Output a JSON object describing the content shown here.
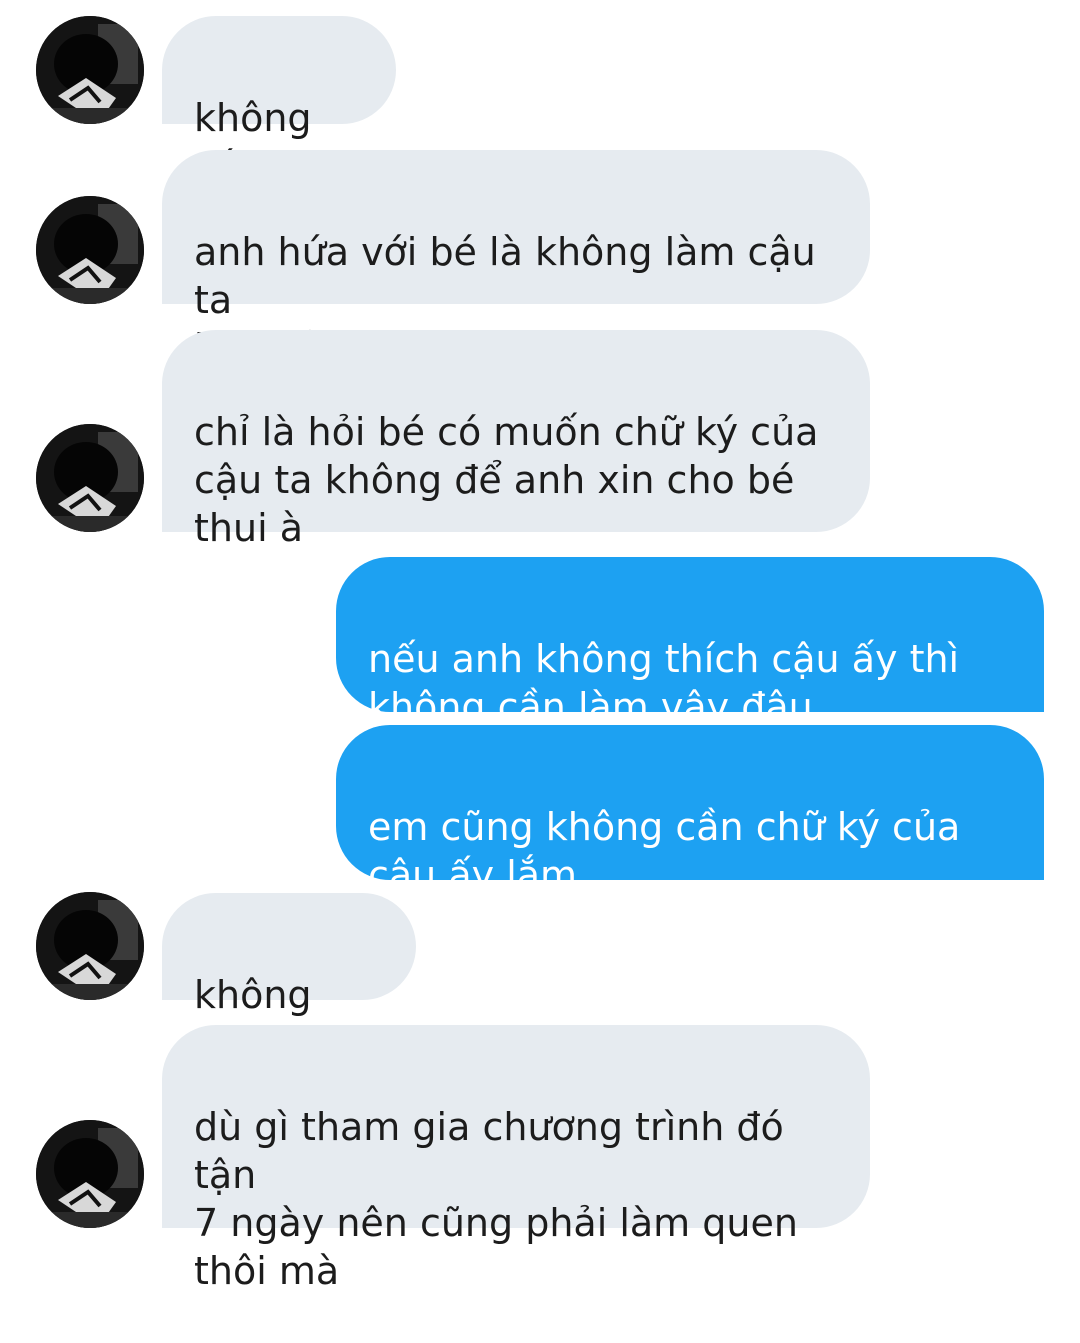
{
  "conversation": {
    "contact_avatar": "avatar-photo",
    "messages": [
      {
        "direction": "incoming",
        "text": "không có"
      },
      {
        "direction": "incoming",
        "text": "anh hứa với bé là không làm cậu ta\nkhó xử thì anh sẽ làm mà"
      },
      {
        "direction": "incoming",
        "text": "chỉ là hỏi bé có muốn chữ ký của\ncậu ta không để anh xin cho bé\nthui à"
      },
      {
        "direction": "outgoing",
        "text": "nếu anh không thích cậu ấy thì\nkhông cần làm vậy đâu"
      },
      {
        "direction": "outgoing",
        "text": "em cũng không cần chữ ký của\ncậu ấy lắm"
      },
      {
        "direction": "incoming",
        "text": "không sao"
      },
      {
        "direction": "incoming",
        "text": "dù gì tham gia chương trình đó tận\n7 ngày nên cũng phải làm quen\nthôi mà"
      }
    ]
  },
  "colors": {
    "incoming_bubble": "#e6ebf0",
    "outgoing_bubble": "#1da1f2",
    "incoming_text": "#1c1c1c",
    "outgoing_text": "#ffffff"
  }
}
